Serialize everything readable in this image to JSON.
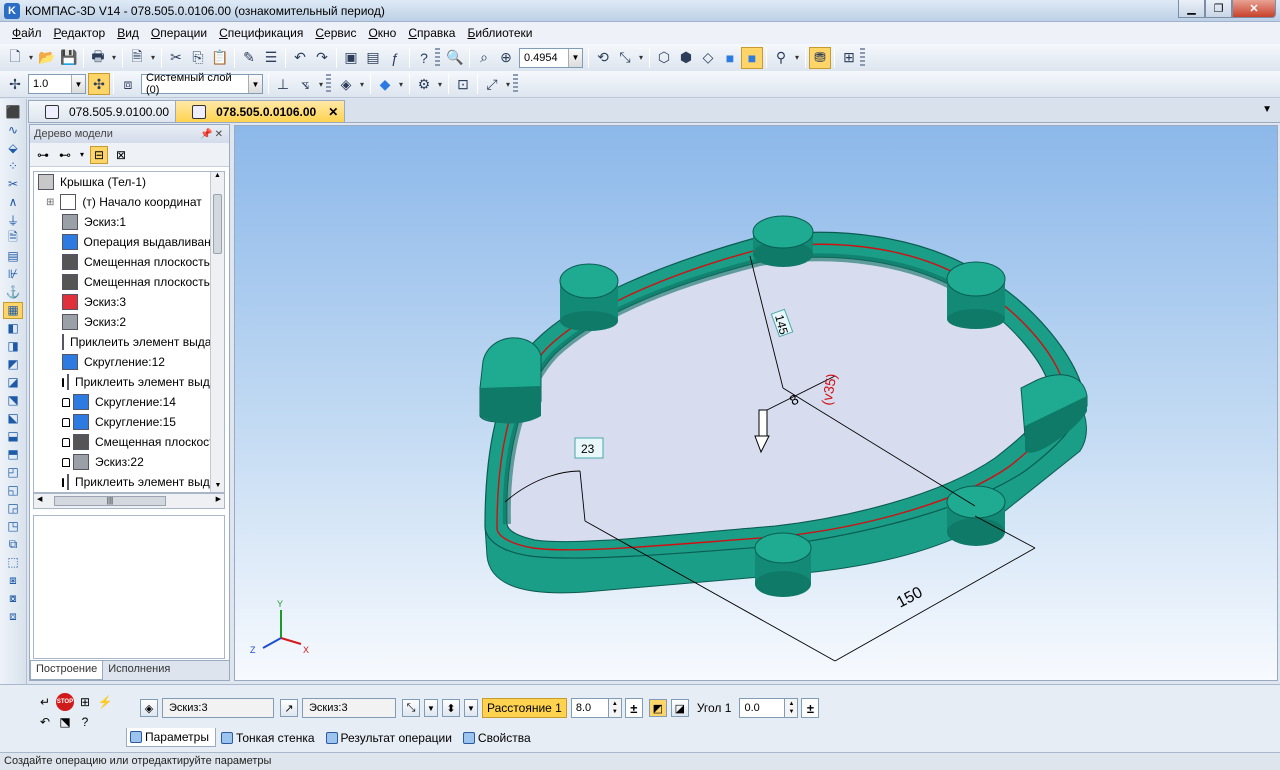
{
  "window": {
    "title": "КОМПАС-3D V14 - 078.505.0.0106.00 (ознакомительный период)"
  },
  "menu": [
    "Файл",
    "Редактор",
    "Вид",
    "Операции",
    "Спецификация",
    "Сервис",
    "Окно",
    "Справка",
    "Библиотеки"
  ],
  "toolbar": {
    "zoom_value": "0.4954",
    "line_width": "1.0",
    "layer": "Системный слой (0)"
  },
  "doc_tabs": [
    {
      "label": "078.505.9.0100.00",
      "active": false
    },
    {
      "label": "078.505.0.0106.00",
      "active": true
    }
  ],
  "tree": {
    "header": "Дерево модели",
    "items": [
      {
        "label": "Крышка (Тел-1)",
        "icon": "part-icon",
        "color": "#c8c8c8"
      },
      {
        "label": "(т) Начало координат",
        "icon": "origin-icon",
        "color": "#ffffff"
      },
      {
        "label": "Эскиз:1",
        "icon": "sketch-icon",
        "color": "#9aa0a6"
      },
      {
        "label": "Операция выдавливания",
        "icon": "extrude-icon",
        "color": "#2d7be0"
      },
      {
        "label": "Смещенная плоскость",
        "icon": "plane-icon",
        "color": "#555555"
      },
      {
        "label": "Смещенная плоскость",
        "icon": "plane-icon",
        "color": "#555555"
      },
      {
        "label": "Эскиз:3",
        "icon": "sketch-icon",
        "color": "#e0303a"
      },
      {
        "label": "Эскиз:2",
        "icon": "sketch-icon",
        "color": "#9aa0a6"
      },
      {
        "label": "Приклеить элемент выдавливания",
        "icon": "boss-icon",
        "color": "#2d7be0"
      },
      {
        "label": "Скругление:12",
        "icon": "fillet-icon",
        "color": "#2d7be0"
      },
      {
        "label": "Приклеить элемент выдавливания",
        "icon": "boss-icon",
        "color": "#2d7be0",
        "locked": true
      },
      {
        "label": "Скругление:14",
        "icon": "fillet-icon",
        "color": "#2d7be0",
        "locked": true
      },
      {
        "label": "Скругление:15",
        "icon": "fillet-icon",
        "color": "#2d7be0",
        "locked": true
      },
      {
        "label": "Смещенная плоскость",
        "icon": "plane-icon",
        "color": "#555555",
        "locked": true
      },
      {
        "label": "Эскиз:22",
        "icon": "sketch-icon",
        "color": "#9aa0a6",
        "locked": true
      },
      {
        "label": "Приклеить элемент выдавливания",
        "icon": "boss-icon",
        "color": "#2d7be0",
        "locked": true
      }
    ],
    "bottom_tabs": [
      "Построение",
      "Исполнения"
    ]
  },
  "viewport": {
    "dim_150": "150",
    "dim_145": "145",
    "dim_8": "8",
    "dim_35": "(v35)",
    "dim_23": "23",
    "axis_x": "X",
    "axis_y": "Y",
    "axis_z": "Z",
    "body_color": "#1a9e88",
    "floor_color": "#d8dcef",
    "outline_color": "#d01010"
  },
  "params": {
    "sketch1": "Эскиз:3",
    "sketch2": "Эскиз:3",
    "distance_label": "Расстояние 1",
    "distance_value": "8.0",
    "angle_label": "Угол 1",
    "angle_value": "0.0",
    "tabs": [
      "Параметры",
      "Тонкая стенка",
      "Результат операции",
      "Свойства"
    ]
  },
  "status": "Создайте операцию или отредактируйте параметры"
}
